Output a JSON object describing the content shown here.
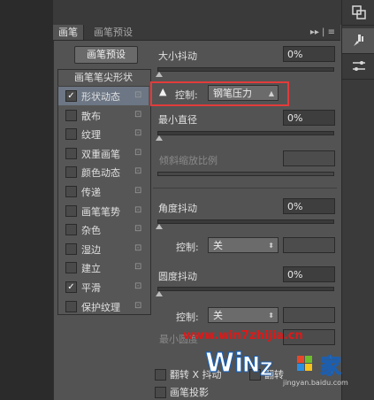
{
  "tabs": [
    "画笔",
    "画笔预设"
  ],
  "panel_controls": "▸▸ | ≡",
  "preset_button": "画笔预设",
  "list_header": "画笔笔尖形状",
  "brush_options": [
    {
      "label": "形状动态",
      "checked": true,
      "selected": true
    },
    {
      "label": "散布",
      "checked": false
    },
    {
      "label": "纹理",
      "checked": false
    },
    {
      "label": "双重画笔",
      "checked": false
    },
    {
      "label": "颜色动态",
      "checked": false
    },
    {
      "label": "传递",
      "checked": false
    },
    {
      "label": "画笔笔势",
      "checked": false
    },
    {
      "label": "杂色",
      "checked": false
    },
    {
      "label": "湿边",
      "checked": false
    },
    {
      "label": "建立",
      "checked": false
    },
    {
      "label": "平滑",
      "checked": true
    },
    {
      "label": "保护纹理",
      "checked": false
    }
  ],
  "lock_glyph": "🔓",
  "size_jitter": {
    "label": "大小抖动",
    "value": "0%"
  },
  "size_control": {
    "warning": "▲",
    "label": "控制:",
    "value": "钢笔压力"
  },
  "min_diameter": {
    "label": "最小直径",
    "value": "0%"
  },
  "tilt_scale": {
    "label": "倾斜缩放比例"
  },
  "angle_jitter": {
    "label": "角度抖动",
    "value": "0%"
  },
  "angle_control": {
    "label": "控制:",
    "value": "关"
  },
  "roundness_jitter": {
    "label": "圆度抖动",
    "value": "0%"
  },
  "roundness_control": {
    "label": "控制:",
    "value": "关"
  },
  "min_roundness": {
    "label": "最小圆度"
  },
  "flip_x": {
    "label": "翻转 X 抖动"
  },
  "flip_y": {
    "label": "翻转"
  },
  "brush_projection": {
    "label": "画笔投影"
  },
  "watermark": {
    "url_text": "www.win7zhijia.cn",
    "logo_text": "Win7之家",
    "site": "jingyan.baidu.com"
  },
  "accent": "#e23b3b"
}
